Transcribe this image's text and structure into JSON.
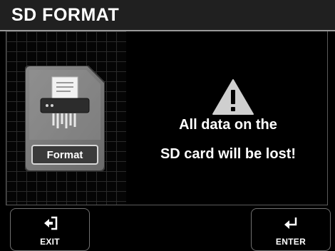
{
  "screen": {
    "title": "SD FORMAT"
  },
  "illustration": {
    "icon": "sd-card-shredder-icon",
    "label": "Format"
  },
  "warning": {
    "icon": "warning-triangle-icon",
    "line1": "All data on the",
    "line2": "SD card will be lost!"
  },
  "softkeys": {
    "exit": {
      "label": "EXIT",
      "icon": "exit-arrow-icon"
    },
    "enter": {
      "label": "ENTER",
      "icon": "enter-return-icon"
    }
  },
  "colors": {
    "background": "#000000",
    "titlebar": "#202020",
    "warning_triangle": "#cfcfcf"
  }
}
